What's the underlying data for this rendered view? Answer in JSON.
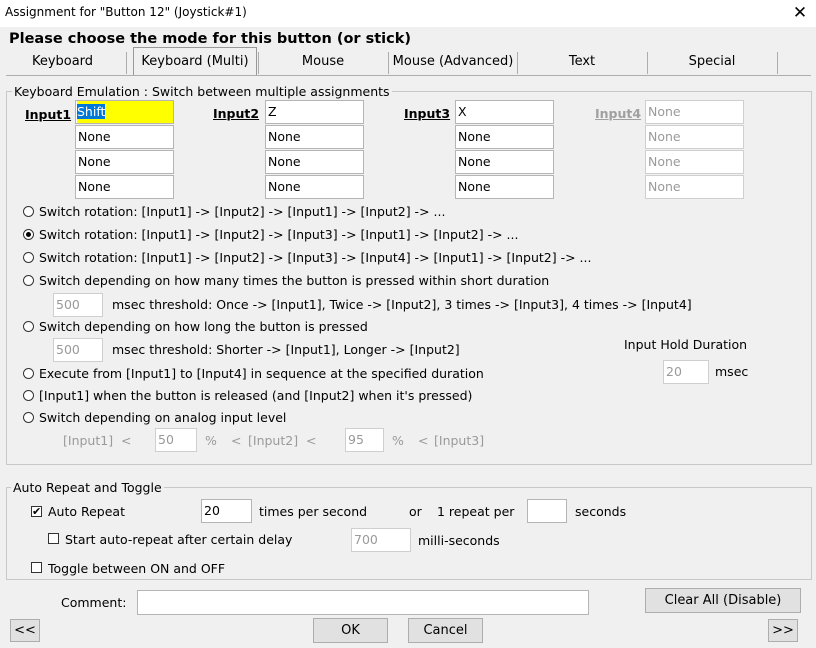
{
  "window": {
    "title": "Assignment for \"Button 12\" (Joystick#1)",
    "close_glyph": "✕"
  },
  "heading": "Please choose the mode for this button (or stick)",
  "tabs": [
    "Keyboard",
    "Keyboard (Multi)",
    "Mouse",
    "Mouse (Advanced)",
    "Text",
    "Special"
  ],
  "emulation": {
    "legend": "Keyboard Emulation : Switch between multiple assignments",
    "inputs": [
      {
        "label": "Input1",
        "values": [
          "Shift",
          "None",
          "None",
          "None"
        ]
      },
      {
        "label": "Input2",
        "values": [
          "Z",
          "None",
          "None",
          "None"
        ]
      },
      {
        "label": "Input3",
        "values": [
          "X",
          "None",
          "None",
          "None"
        ]
      },
      {
        "label": "Input4",
        "values": [
          "None",
          "None",
          "None",
          "None"
        ]
      }
    ],
    "options": [
      "Switch rotation: [Input1] -> [Input2] -> [Input1] -> [Input2] -> ...",
      "Switch rotation: [Input1] -> [Input2] -> [Input3] -> [Input1] -> [Input2] -> ...",
      "Switch rotation: [Input1] -> [Input2] -> [Input3] -> [Input4] -> [Input1] -> [Input2] -> ...",
      "Switch depending on how many times the button is pressed within short duration",
      "Switch depending on how long the button is pressed",
      "Execute from [Input1] to [Input4] in sequence at the specified duration",
      "[Input1] when the button is released (and [Input2] when it's pressed)",
      "Switch depending on analog input level"
    ],
    "selected_option": 1,
    "press_count": {
      "value": "500",
      "text": "msec threshold: Once -> [Input1], Twice -> [Input2], 3 times -> [Input3], 4 times -> [Input4]"
    },
    "press_length": {
      "value": "500",
      "text": "msec threshold: Shorter -> [Input1], Longer -> [Input2]"
    },
    "hold_duration": {
      "label": "Input Hold Duration",
      "value": "20",
      "unit": "msec"
    },
    "analog": {
      "in1": "[Input1]",
      "lt": "<",
      "v1": "50",
      "pct": "%",
      "in2": "[Input2]",
      "v2": "95",
      "in3": "[Input3]"
    }
  },
  "auto_repeat": {
    "legend": "Auto Repeat and Toggle",
    "auto_repeat_label": "Auto Repeat",
    "auto_repeat_checked": true,
    "rate_value": "20",
    "rate_unit": "times per second",
    "or": "or",
    "repeat_per": "1 repeat per",
    "seconds_value": "",
    "seconds_unit": "seconds",
    "delay_label": "Start auto-repeat after certain delay",
    "delay_checked": false,
    "delay_value": "700",
    "delay_unit": "milli-seconds",
    "toggle_label": "Toggle between ON and OFF",
    "toggle_checked": false
  },
  "footer": {
    "comment_label": "Comment:",
    "comment_value": "",
    "clear_all": "Clear All (Disable)",
    "prev": "<<",
    "ok": "OK",
    "cancel": "Cancel",
    "next": ">>"
  }
}
